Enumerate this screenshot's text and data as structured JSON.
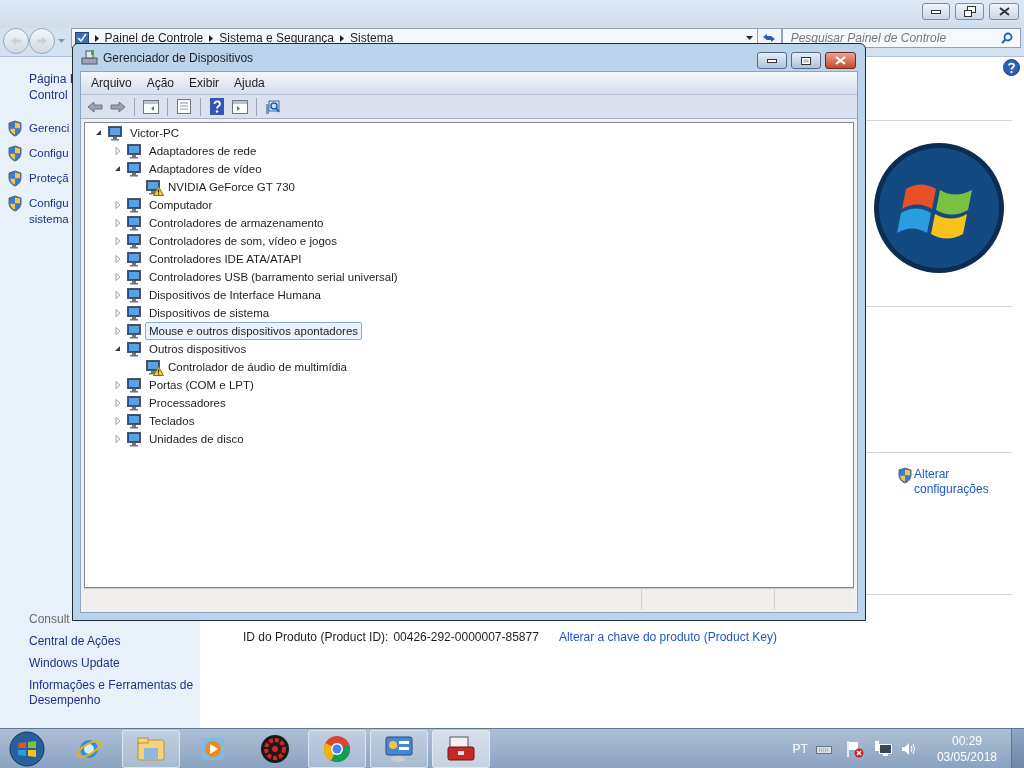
{
  "control_panel": {
    "breadcrumb": [
      "Painel de Controle",
      "Sistema e Segurança",
      "Sistema"
    ],
    "search": {
      "placeholder": "Pesquisar Painel de Controle"
    },
    "sidebar": {
      "home_link": [
        "Página I",
        "Control"
      ],
      "tasks": [
        {
          "lines": [
            "Gerenci"
          ]
        },
        {
          "lines": [
            "Configu"
          ]
        },
        {
          "lines": [
            "Proteçã"
          ]
        },
        {
          "lines": [
            "Configu",
            "sistema"
          ]
        }
      ],
      "see_also_heading": "Consult",
      "see_also": [
        "Central de Ações",
        "Windows Update",
        "Informações e Ferramentas de Desempenho"
      ]
    },
    "change_settings_link": [
      "Alterar",
      "configurações"
    ],
    "product_id": {
      "label": "ID do Produto (Product ID):",
      "value": "00426-292-0000007-85877",
      "link": "Alterar a chave do produto (Product Key)"
    }
  },
  "device_manager": {
    "title": "Gerenciador de Dispositivos",
    "menu": [
      "Arquivo",
      "Ação",
      "Exibir",
      "Ajuda"
    ],
    "tree": {
      "label": "Victor-PC",
      "expanded": true,
      "selected": false,
      "children": [
        {
          "label": "Adaptadores de rede",
          "expanded": false,
          "selected": false
        },
        {
          "label": "Adaptadores de vídeo",
          "expanded": true,
          "selected": false,
          "children": [
            {
              "label": "NVIDIA GeForce GT 730",
              "selected": false,
              "warning": true
            }
          ]
        },
        {
          "label": "Computador",
          "expanded": false,
          "selected": false
        },
        {
          "label": "Controladores de armazenamento",
          "expanded": false,
          "selected": false
        },
        {
          "label": "Controladores de som, vídeo e jogos",
          "expanded": false,
          "selected": false
        },
        {
          "label": "Controladores IDE ATA/ATAPI",
          "expanded": false,
          "selected": false
        },
        {
          "label": "Controladores USB (barramento serial universal)",
          "expanded": false,
          "selected": false
        },
        {
          "label": "Dispositivos de Interface Humana",
          "expanded": false,
          "selected": false
        },
        {
          "label": "Dispositivos de sistema",
          "expanded": false,
          "selected": false
        },
        {
          "label": "Mouse e outros dispositivos apontadores",
          "expanded": false,
          "selected": true
        },
        {
          "label": "Outros dispositivos",
          "expanded": true,
          "selected": false,
          "children": [
            {
              "label": "Controlador de áudio de multimídia",
              "selected": false,
              "warning": true
            }
          ]
        },
        {
          "label": "Portas (COM e LPT)",
          "expanded": false,
          "selected": false
        },
        {
          "label": "Processadores",
          "expanded": false,
          "selected": false
        },
        {
          "label": "Teclados",
          "expanded": false,
          "selected": false
        },
        {
          "label": "Unidades de disco",
          "expanded": false,
          "selected": false
        }
      ]
    }
  },
  "taskbar": {
    "buttons": [
      {
        "open": false,
        "active": false
      },
      {
        "open": true,
        "active": false
      },
      {
        "open": false,
        "active": false
      },
      {
        "open": false,
        "active": false
      },
      {
        "open": true,
        "active": false
      },
      {
        "open": true,
        "active": false
      },
      {
        "open": true,
        "active": true
      }
    ],
    "tray": {
      "language": "PT",
      "time": "00:29",
      "date": "03/05/2018"
    }
  }
}
